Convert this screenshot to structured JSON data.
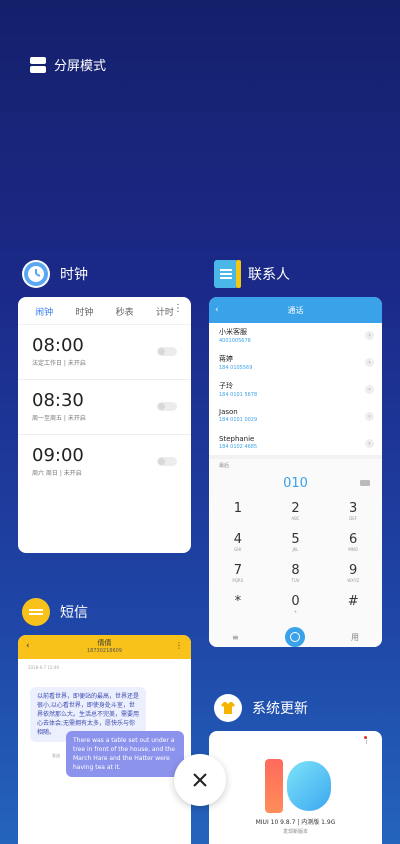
{
  "split_mode": {
    "label": "分屏模式",
    "icon": "split-screen-icon"
  },
  "clock": {
    "app_name": "时钟",
    "icon": "clock-icon",
    "tabs": [
      "闹钟",
      "时钟",
      "秒表",
      "计时"
    ],
    "active_tab": "闹钟",
    "more": "⋮",
    "alarms": [
      {
        "time": "08:00",
        "desc": "法定工作日 | 未开启"
      },
      {
        "time": "08:30",
        "desc": "周一至周五 | 未开启"
      },
      {
        "time": "09:00",
        "desc": "周六 周日 | 未开启"
      }
    ]
  },
  "contacts": {
    "app_name": "联系人",
    "icon": "contacts-book-icon",
    "bar_title": "通话",
    "back": "‹",
    "list": [
      {
        "name": "小米客服",
        "number": "4001005678"
      },
      {
        "name": "蒋婷",
        "number": "184 0105569"
      },
      {
        "name": "子玲",
        "number": "184 0101 5678"
      },
      {
        "name": "Jason",
        "number": "184 0101 0029"
      },
      {
        "name": "Stephanie",
        "number": "184 0102 4685"
      }
    ],
    "dial_label": "最后",
    "dial_number": "010",
    "keys": [
      {
        "d": "1",
        "l": ""
      },
      {
        "d": "2",
        "l": "ABC"
      },
      {
        "d": "3",
        "l": "DEF"
      },
      {
        "d": "4",
        "l": "GHI"
      },
      {
        "d": "5",
        "l": "JKL"
      },
      {
        "d": "6",
        "l": "MNO"
      },
      {
        "d": "7",
        "l": "PQRS"
      },
      {
        "d": "8",
        "l": "TUV"
      },
      {
        "d": "9",
        "l": "WXYZ"
      },
      {
        "d": "*",
        "l": ""
      },
      {
        "d": "0",
        "l": "+"
      },
      {
        "d": "#",
        "l": ""
      }
    ],
    "bottom_left": "≡",
    "bottom_right": "用"
  },
  "messages": {
    "app_name": "短信",
    "icon": "chat-bubble-icon",
    "back": "‹",
    "more": "⋮",
    "title": "倩倩",
    "phone": "18730218609",
    "date": "2018-6-7 15:49",
    "incoming": "以前看世界，即便站的最高，世界还是很小,以心看世界，即使身处斗室，世界依然那么大。生活总不完美，需要用心去体会;无需拥有太多，愿快乐与你相随。",
    "outgoing": "There was a table set out under a tree in front of the house, and the March Hare and the Hatter were having tea at it.",
    "outgoing_meta": "发送"
  },
  "system_update": {
    "app_name": "系统更新",
    "icon": "update-shirt-icon",
    "more": "⋮",
    "version": "MIUI 10 9.8.7 | 内测版 1.9G",
    "subtitle": "发现新版本"
  },
  "close_button": {
    "icon": "close-icon",
    "label": "✕"
  },
  "colors": {
    "accent_blue": "#3aa2e8",
    "message_yellow": "#f8c21a",
    "clock_blue": "#3b7df0"
  }
}
